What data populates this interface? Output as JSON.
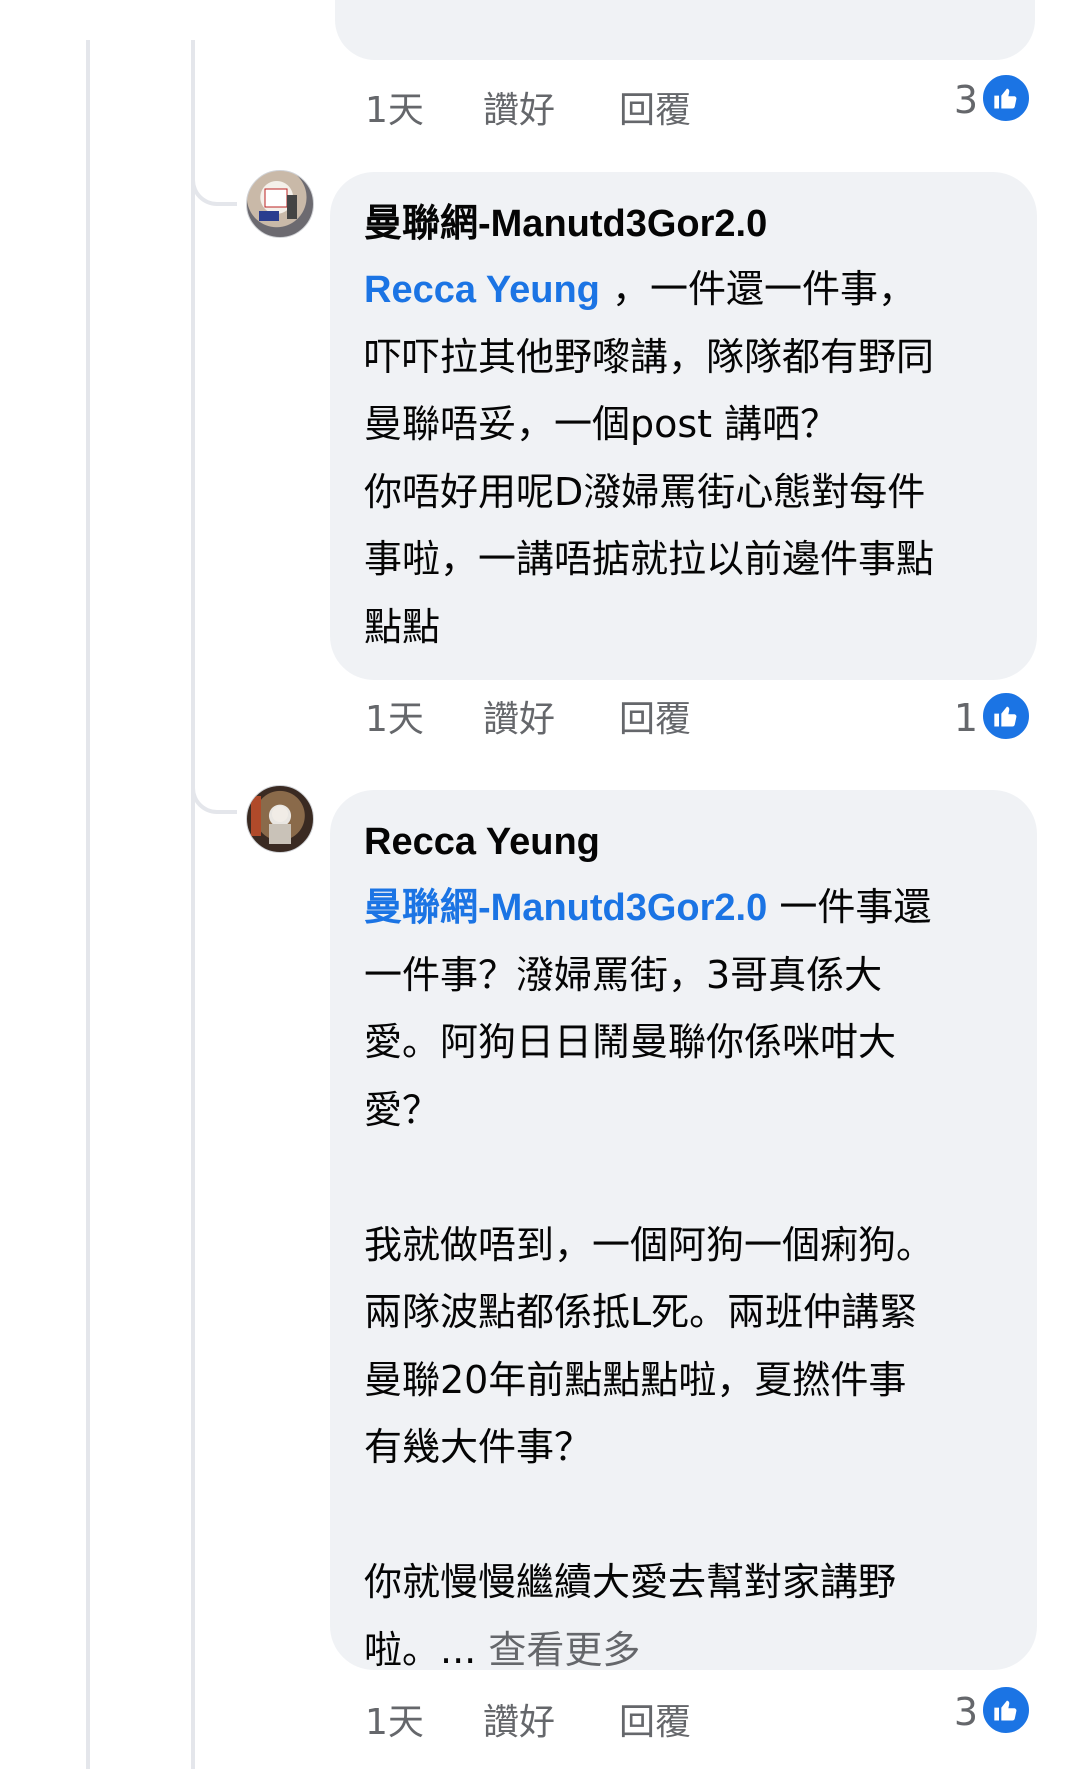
{
  "colors": {
    "mention": "#1b74e4",
    "meta_text": "#65676b",
    "bubble_bg": "#f0f2f5",
    "like_badge": "#1b74e4",
    "thread_line": "#e4e6eb"
  },
  "comments": [
    {
      "actions": {
        "time": "1天",
        "like": "讚好",
        "reply": "回覆"
      },
      "reaction_count": "3",
      "reaction_icon": "like-icon"
    },
    {
      "author": "曼聯網-Manutd3Gor2.0",
      "avatar_icon": "avatar-photo",
      "lines": [
        {
          "mention": "Recca Yeung",
          "text": " ，一件還一件事，"
        },
        {
          "text": "吓吓拉其他野嚟講，隊隊都有野同"
        },
        {
          "text": "曼聯唔妥，一個post 講哂？"
        },
        {
          "text": "你唔好用呢D潑婦罵街心態對每件"
        },
        {
          "text": "事啦，一講唔掂就拉以前邊件事點"
        },
        {
          "text": "點點"
        }
      ],
      "actions": {
        "time": "1天",
        "like": "讚好",
        "reply": "回覆"
      },
      "reaction_count": "1",
      "reaction_icon": "like-icon"
    },
    {
      "author": "Recca Yeung",
      "avatar_icon": "avatar-photo",
      "lines": [
        {
          "mention": "曼聯網-Manutd3Gor2.0",
          "text": " 一件事還"
        },
        {
          "text": "一件事？潑婦罵街，3哥真係大"
        },
        {
          "text": "愛。阿狗日日鬧曼聯你係咪咁大"
        },
        {
          "text": "愛？"
        },
        {
          "text": ""
        },
        {
          "text": "我就做唔到，一個阿狗一個痢狗。"
        },
        {
          "text": "兩隊波點都係抵L死。兩班仲講緊"
        },
        {
          "text": "曼聯20年前點點點啦，夏撚件事"
        },
        {
          "text": "有幾大件事？"
        },
        {
          "text": ""
        },
        {
          "text": "你就慢慢繼續大愛去幫對家講野"
        },
        {
          "text": "啦。...",
          "see_more": "查看更多"
        }
      ],
      "actions": {
        "time": "1天",
        "like": "讚好",
        "reply": "回覆"
      },
      "reaction_count": "3",
      "reaction_icon": "like-icon"
    }
  ]
}
